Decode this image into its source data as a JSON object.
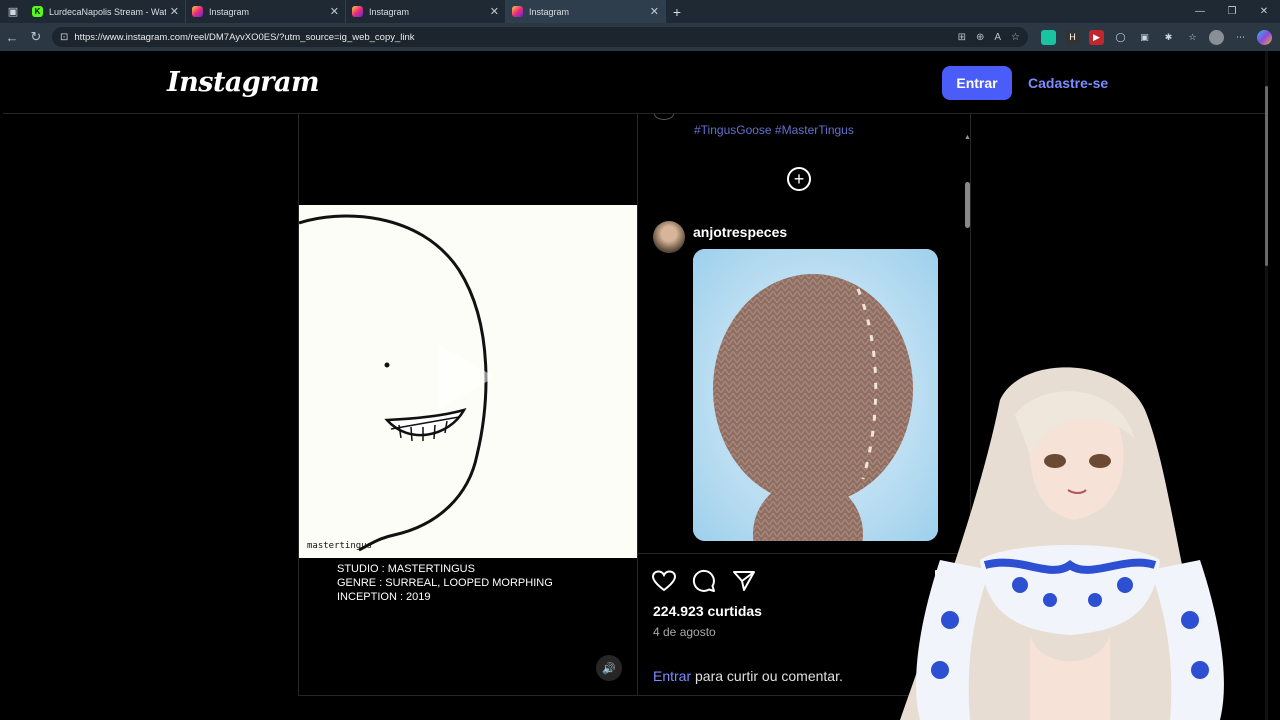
{
  "browser": {
    "tabs": [
      {
        "title": "LurdecaNapolis Stream - Watch L",
        "favicon": "kick"
      },
      {
        "title": "Instagram",
        "favicon": "instagram"
      },
      {
        "title": "Instagram",
        "favicon": "instagram"
      },
      {
        "title": "Instagram",
        "favicon": "instagram",
        "active": true
      }
    ],
    "url": "https://www.instagram.com/reel/DM7AyvXO0ES/?utm_source=ig_web_copy_link"
  },
  "header": {
    "logo": "Instagram",
    "login_label": "Entrar",
    "signup_label": "Cadastre-se"
  },
  "video": {
    "watermark": "mastertingus",
    "caption_lines": [
      "STUDIO : MASTERTINGUS",
      "GENRE : SURREAL, LOOPED MORPHING",
      "INCEPTION : 2019"
    ]
  },
  "comments": {
    "cut_off_tags": "#TingusGoose #MasterTingus",
    "comment_user": "anjotrespeces"
  },
  "post": {
    "likes": "224.923 curtidas",
    "date": "4 de agosto",
    "login_link": "Entrar",
    "login_text": " para curtir ou comentar."
  },
  "colors": {
    "accent": "#4a5df9",
    "link": "#7b8cff",
    "background": "#000000"
  }
}
